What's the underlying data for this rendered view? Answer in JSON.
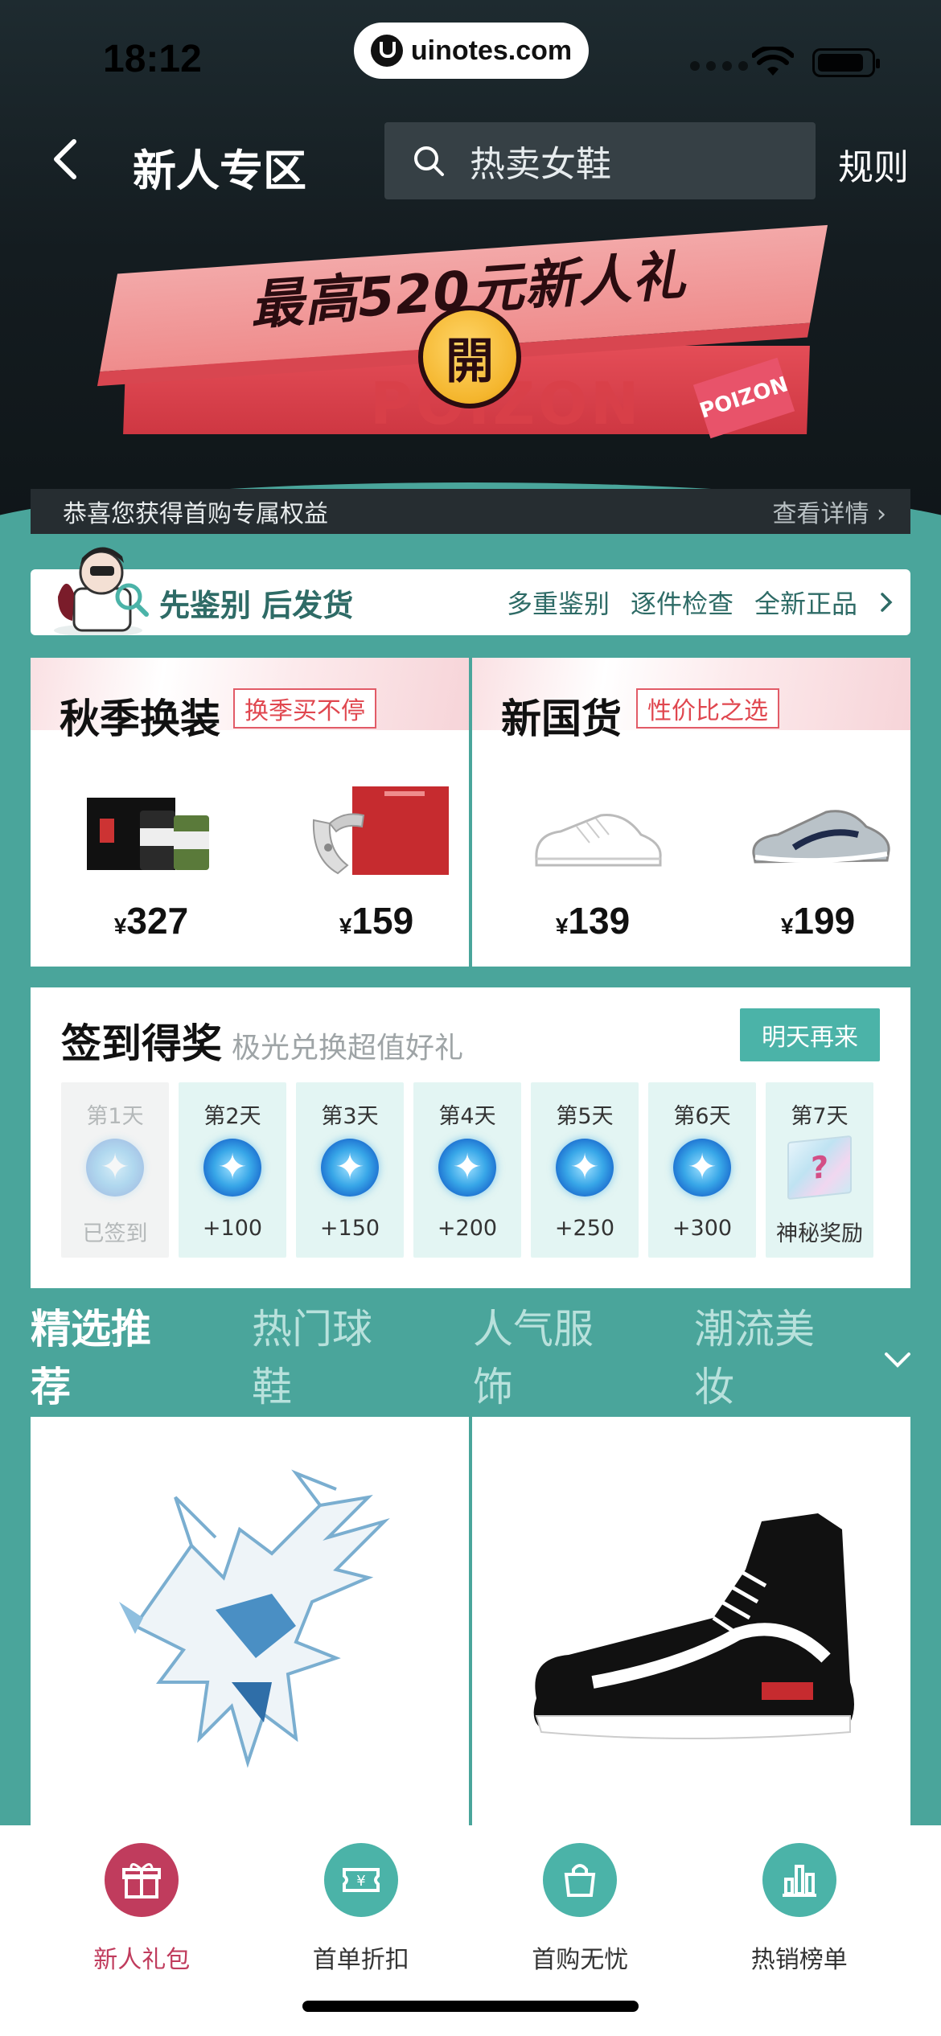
{
  "status_bar": {
    "time": "18:12"
  },
  "watermark": {
    "text": "uinotes.com"
  },
  "nav": {
    "title": "新人专区",
    "search_text": "热卖女鞋",
    "rules": "规则"
  },
  "banner": {
    "gift_title": "最高520元新人礼",
    "open_label": "開",
    "brand": "POIZON",
    "sticker": "POIZON",
    "benefit_text": "恭喜您获得首购专属权益",
    "benefit_link": "查看详情 ›"
  },
  "verify": {
    "title": "先鉴别 后发货",
    "tags": [
      "多重鉴别",
      "逐件检查",
      "全新正品"
    ]
  },
  "promo": [
    {
      "title": "秋季换装",
      "tag": "换季买不停",
      "items": [
        {
          "currency": "¥",
          "price": "327"
        },
        {
          "currency": "¥",
          "price": "159"
        }
      ]
    },
    {
      "title": "新国货",
      "tag": "性价比之选",
      "items": [
        {
          "currency": "¥",
          "price": "139"
        },
        {
          "currency": "¥",
          "price": "199"
        }
      ]
    }
  ],
  "checkin": {
    "title": "签到得奖",
    "subtitle": "极光兑换超值好礼",
    "button": "明天再来",
    "days": [
      {
        "label": "第1天",
        "reward": "已签到",
        "done": true
      },
      {
        "label": "第2天",
        "reward": "+100"
      },
      {
        "label": "第3天",
        "reward": "+150"
      },
      {
        "label": "第4天",
        "reward": "+200"
      },
      {
        "label": "第5天",
        "reward": "+250"
      },
      {
        "label": "第6天",
        "reward": "+300"
      },
      {
        "label": "第7天",
        "reward": "神秘奖励",
        "mystery": true
      }
    ]
  },
  "categories": {
    "tabs": [
      "精选推荐",
      "热门球鞋",
      "人气服饰",
      "潮流美妆"
    ],
    "active_index": 0
  },
  "tabbar": {
    "tabs": [
      {
        "label": "新人礼包",
        "icon": "gift-icon",
        "active": true
      },
      {
        "label": "首单折扣",
        "icon": "ticket-icon"
      },
      {
        "label": "首购无忧",
        "icon": "bag-icon"
      },
      {
        "label": "热销榜单",
        "icon": "ranking-icon"
      }
    ]
  },
  "colors": {
    "teal": "#4aa59b",
    "accent_red": "#c03c5d",
    "tag_red": "#e0474f"
  }
}
